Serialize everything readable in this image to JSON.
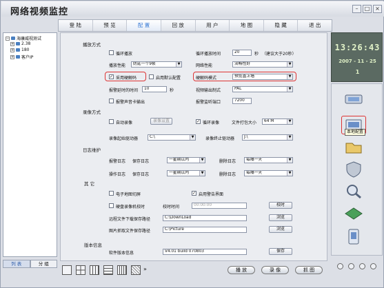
{
  "app": {
    "title": "网络视频监控"
  },
  "nav": {
    "items": [
      "登 陆",
      "预 览",
      "配 置",
      "回 放",
      "用 户",
      "地 图",
      "隐 藏",
      "退 出"
    ],
    "active_index": 2
  },
  "tree": {
    "root": "海康威视测试",
    "children": [
      "2.38",
      "180",
      "客户IP"
    ]
  },
  "tree_tabs": {
    "list": "列 表",
    "group": "分 组"
  },
  "playback": {
    "section": "播放方式",
    "loop_play": "循环播放",
    "loop_time_label": "循环播放时间",
    "loop_time_value": "20",
    "loop_time_unit": "秒",
    "loop_time_hint": "（建议大于20秒）",
    "play_perf_label": "播放性能",
    "play_perf_value": "防延一个9帧",
    "net_perf_label": "网络性能",
    "net_perf_value": "流畅性好",
    "hw_decode": "采用硬解码",
    "default_config": "启用默认配置",
    "hw_decode_mode_label": "硬解码模式",
    "hw_decode_mode_value": "预览直上墙",
    "alarm_delay_label": "报警延时的时间",
    "alarm_delay_value": "10",
    "alarm_delay_unit": "秒",
    "video_out_label": "视频输出制式",
    "video_out_value": "PAL",
    "alarm_sound": "报警声音卡输出",
    "alarm_port_label": "报警监听端口",
    "alarm_port_value": "7200"
  },
  "recording": {
    "section": "录像方式",
    "auto_record": "自动录像",
    "record_settings": "录像设置",
    "loop_record": "循环录像",
    "file_size_label": "文件打包大小",
    "file_size_value": "64 M",
    "start_drive_label": "录像起始驱动器",
    "start_drive_value": "C:\\",
    "end_drive_label": "录像终止驱动器",
    "end_drive_value": "J:\\"
  },
  "log": {
    "section": "日志维护",
    "alarm_log": "报警日志",
    "save_log": "保存日志",
    "save_log_value": "一星期以内",
    "delete_log": "删除日志",
    "delete_log_value": "每隔一天",
    "op_log": "操作日志",
    "op_save_value": "一星期以内",
    "op_delete_value": "每隔一天"
  },
  "other": {
    "section": "其  它",
    "emap": "电子地图切屏",
    "alarm_ui": "启用警告界面",
    "disk_sync": "硬盘录像机校时",
    "sync_time_label": "校时时间",
    "sync_time_value": "00:00:00",
    "sync_button": "校时",
    "download_path_label": "远程文件下载保存路径",
    "download_path_value": "C:\\DownLoad",
    "browse_1": "浏览",
    "picture_path_label": "图片抓取文件保存路径",
    "picture_path_value": "C:\\Picture",
    "browse_2": "浏览"
  },
  "version": {
    "section": "版本信息",
    "label": "软件版本信息",
    "value": "V4.01 build 070803",
    "save_button": "保存"
  },
  "clock": {
    "time": "13:26:43",
    "date": "2007 - 11 - 25",
    "day": "1"
  },
  "right_tooltip": "本地配置",
  "bottom": {
    "more": "»",
    "play": "播 放",
    "record": "录 像",
    "capture": "抓 图"
  },
  "colors": {
    "accent": "#3a7bd5",
    "highlight": "#dd3333",
    "clock_bg": "#5b6a62",
    "clock_text": "#e2f3c8"
  }
}
